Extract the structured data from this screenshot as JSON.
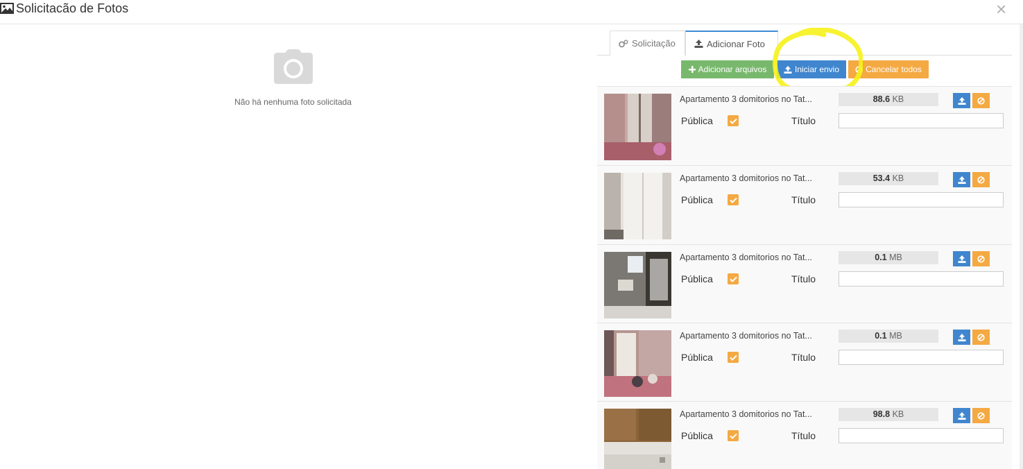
{
  "window": {
    "title": "Solicitacão de Fotos"
  },
  "empty_state": {
    "message": "Não há nenhuma foto solicitada"
  },
  "tabs": [
    {
      "label": "Solicitação",
      "active": false
    },
    {
      "label": "Adicionar Foto",
      "active": true
    }
  ],
  "toolbar": {
    "add_label": "Adicionar arquivos",
    "start_label": "Iniciar envio",
    "cancel_label": "Cancelar todos"
  },
  "files": [
    {
      "name": "Apartamento 3 domitorios no Tat...",
      "size": "88.6",
      "unit": "KB",
      "public_label": "Pública",
      "title_label": "Título",
      "title_value": "",
      "public": true
    },
    {
      "name": "Apartamento 3 domitorios no Tat...",
      "size": "53.4",
      "unit": "KB",
      "public_label": "Pública",
      "title_label": "Título",
      "title_value": "",
      "public": true
    },
    {
      "name": "Apartamento 3 domitorios no Tat...",
      "size": "0.1",
      "unit": "MB",
      "public_label": "Pública",
      "title_label": "Título",
      "title_value": "",
      "public": true
    },
    {
      "name": "Apartamento 3 domitorios no Tat...",
      "size": "0.1",
      "unit": "MB",
      "public_label": "Pública",
      "title_label": "Título",
      "title_value": "",
      "public": true
    },
    {
      "name": "Apartamento 3 domitorios no Tat...",
      "size": "98.8",
      "unit": "KB",
      "public_label": "Pública",
      "title_label": "Título",
      "title_value": "",
      "public": true
    }
  ],
  "icons": {
    "header": "image-icon",
    "close": "close-icon",
    "empty": "camera-icon",
    "tab1": "gears-icon",
    "tab2": "upload-icon",
    "add": "plus-icon",
    "start": "upload-icon",
    "cancel": "ban-icon"
  },
  "colors": {
    "primary": "#3f86cf",
    "success": "#78b86c",
    "warning": "#f5a942",
    "highlight": "#f6f21a"
  }
}
